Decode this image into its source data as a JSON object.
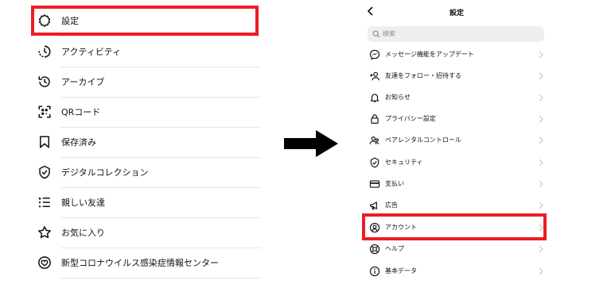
{
  "colors": {
    "highlight": "#ee1c25",
    "separator": "#e6e6e6",
    "chevron": "#c7c7c7",
    "search_bg": "#efefef"
  },
  "left_menu": {
    "items": [
      {
        "label": "設定",
        "icon": "gear-icon"
      },
      {
        "label": "アクティビティ",
        "icon": "activity-icon"
      },
      {
        "label": "アーカイブ",
        "icon": "archive-icon"
      },
      {
        "label": "QRコード",
        "icon": "qr-code-icon"
      },
      {
        "label": "保存済み",
        "icon": "bookmark-icon"
      },
      {
        "label": "デジタルコレクション",
        "icon": "digital-collection-icon"
      },
      {
        "label": "親しい友達",
        "icon": "close-friends-list-icon"
      },
      {
        "label": "お気に入り",
        "icon": "star-icon"
      },
      {
        "label": "新型コロナウイルス感染症情報センター",
        "icon": "covid-info-icon"
      }
    ]
  },
  "settings_screen": {
    "title": "設定",
    "search_placeholder": "検索",
    "items": [
      {
        "label": "メッセージ機能をアップデート",
        "icon": "messenger-icon"
      },
      {
        "label": "友達をフォロー・招待する",
        "icon": "add-person-icon"
      },
      {
        "label": "お知らせ",
        "icon": "bell-icon"
      },
      {
        "label": "プライバシー設定",
        "icon": "lock-icon"
      },
      {
        "label": "ペアレンタルコントロール",
        "icon": "parental-control-icon"
      },
      {
        "label": "セキュリティ",
        "icon": "shield-icon"
      },
      {
        "label": "支払い",
        "icon": "card-icon"
      },
      {
        "label": "広告",
        "icon": "megaphone-icon"
      },
      {
        "label": "アカウント",
        "icon": "account-icon"
      },
      {
        "label": "ヘルプ",
        "icon": "lifebuoy-icon"
      },
      {
        "label": "基本データ",
        "icon": "info-icon"
      }
    ]
  }
}
